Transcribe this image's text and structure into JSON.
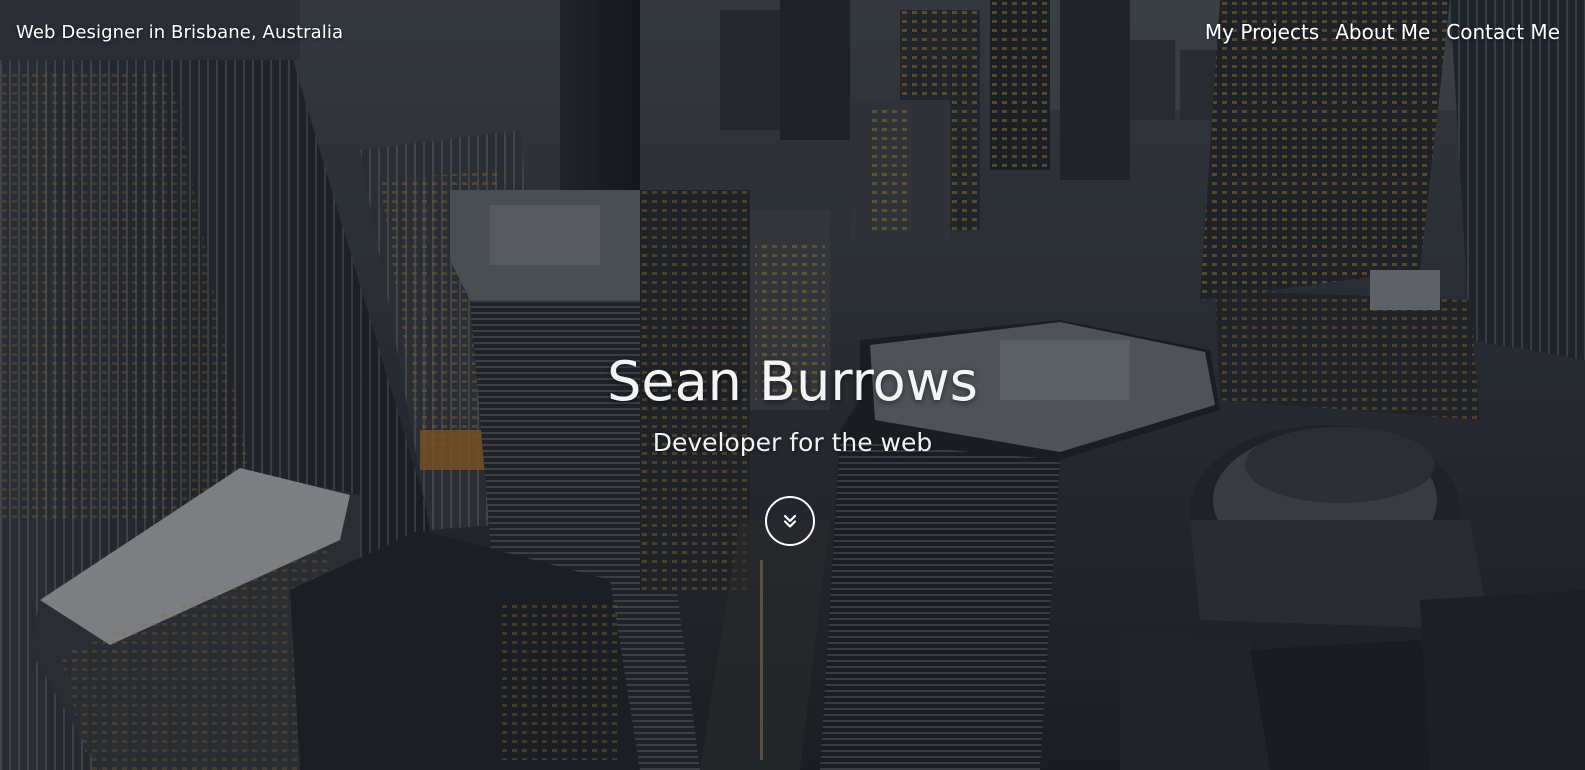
{
  "header": {
    "brand": "Web Designer in Brisbane, Australia",
    "nav": [
      {
        "label": "My Projects"
      },
      {
        "label": "About Me"
      },
      {
        "label": "Contact Me"
      }
    ]
  },
  "hero": {
    "title": "Sean Burrows",
    "subtitle": "Developer for the web",
    "scroll_icon": "double-chevron-down-icon",
    "scroll_color": "#ffffff"
  },
  "background": {
    "subject": "aerial-city-skyline-photo",
    "tint": "#14171c"
  }
}
